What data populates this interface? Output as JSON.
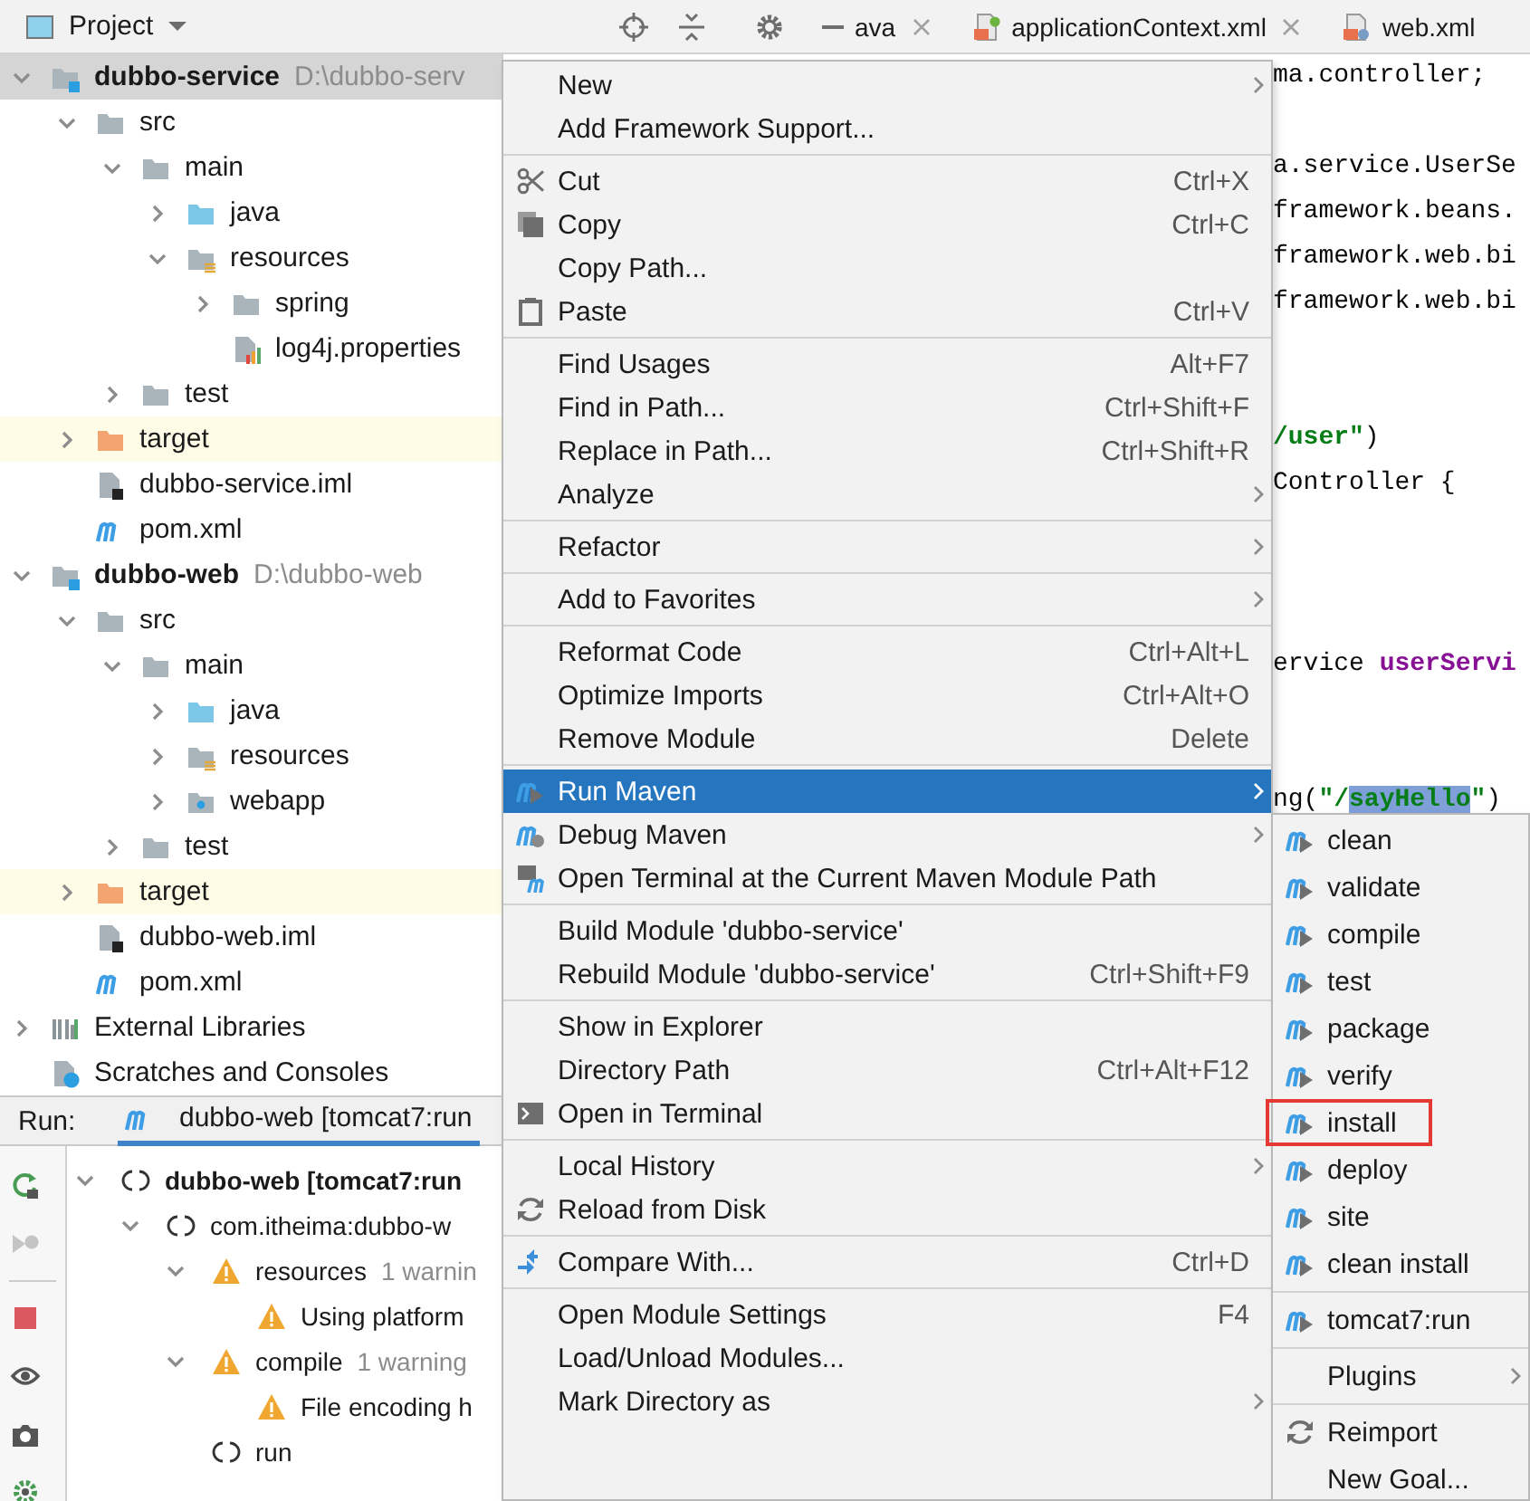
{
  "header": {
    "view": "Project",
    "tabs": [
      {
        "label": "ava",
        "selected": false,
        "closable": true
      },
      {
        "label": "applicationContext.xml",
        "kind": "spring-xml",
        "selected": false,
        "closable": true
      },
      {
        "label": "web.xml",
        "kind": "xml",
        "selected": false,
        "closable": false
      }
    ]
  },
  "project_tree": {
    "items": [
      {
        "label": "dubbo-service",
        "kind": "module",
        "path": "D:\\dubbo-serv",
        "expanded": true,
        "selected": true,
        "children": [
          {
            "label": "src",
            "kind": "folder",
            "expanded": true,
            "selected": false,
            "children": [
              {
                "label": "main",
                "kind": "folder",
                "expanded": true,
                "selected": false,
                "children": [
                  {
                    "label": "java",
                    "kind": "source-folder",
                    "expanded": false,
                    "selected": false
                  },
                  {
                    "label": "resources",
                    "kind": "resource-folder",
                    "expanded": true,
                    "selected": false,
                    "children": [
                      {
                        "label": "spring",
                        "kind": "folder",
                        "expanded": false,
                        "selected": false
                      },
                      {
                        "label": "log4j.properties",
                        "kind": "properties-file",
                        "selected": false
                      }
                    ]
                  }
                ]
              },
              {
                "label": "test",
                "kind": "folder",
                "expanded": false,
                "selected": false
              }
            ]
          },
          {
            "label": "target",
            "kind": "excluded-folder",
            "expanded": false,
            "selected": false
          },
          {
            "label": "dubbo-service.iml",
            "kind": "module-file",
            "selected": false
          },
          {
            "label": "pom.xml",
            "kind": "maven-file",
            "selected": false
          }
        ]
      },
      {
        "label": "dubbo-web",
        "kind": "module",
        "path": "D:\\dubbo-web",
        "expanded": true,
        "selected": false,
        "children": [
          {
            "label": "src",
            "kind": "folder",
            "expanded": true,
            "selected": false,
            "children": [
              {
                "label": "main",
                "kind": "folder",
                "expanded": true,
                "selected": false,
                "children": [
                  {
                    "label": "java",
                    "kind": "source-folder",
                    "expanded": false,
                    "selected": false
                  },
                  {
                    "label": "resources",
                    "kind": "resource-folder",
                    "expanded": false,
                    "selected": false
                  },
                  {
                    "label": "webapp",
                    "kind": "web-folder",
                    "expanded": false,
                    "selected": false
                  }
                ]
              },
              {
                "label": "test",
                "kind": "folder",
                "expanded": false,
                "selected": false
              }
            ]
          },
          {
            "label": "target",
            "kind": "excluded-folder",
            "expanded": false,
            "selected": false
          },
          {
            "label": "dubbo-web.iml",
            "kind": "module-file",
            "selected": false
          },
          {
            "label": "pom.xml",
            "kind": "maven-file",
            "selected": false
          }
        ]
      },
      {
        "label": "External Libraries",
        "kind": "libraries",
        "expanded": false,
        "selected": false
      },
      {
        "label": "Scratches and Consoles",
        "kind": "scratches",
        "selected": false
      }
    ]
  },
  "editor": {
    "lines": [
      {
        "kind": "code",
        "tokens": [
          {
            "text": "ma.controller;",
            "kind": "plain"
          }
        ]
      },
      {
        "kind": "blank"
      },
      {
        "kind": "code",
        "tokens": [
          {
            "text": "a.service.UserSe",
            "kind": "plain"
          }
        ]
      },
      {
        "kind": "code",
        "tokens": [
          {
            "text": "framework.beans.",
            "kind": "plain"
          }
        ]
      },
      {
        "kind": "code",
        "tokens": [
          {
            "text": "framework.web.bi",
            "kind": "plain"
          }
        ]
      },
      {
        "kind": "code",
        "tokens": [
          {
            "text": "framework.web.bi",
            "kind": "plain"
          }
        ]
      },
      {
        "kind": "blank"
      },
      {
        "kind": "blank"
      },
      {
        "kind": "code",
        "tokens": [
          {
            "text": "/user\"",
            "kind": "string"
          },
          {
            "text": ")",
            "kind": "plain"
          }
        ]
      },
      {
        "kind": "code",
        "tokens": [
          {
            "text": "Controller {",
            "kind": "plain"
          }
        ]
      },
      {
        "kind": "blank"
      },
      {
        "kind": "blank"
      },
      {
        "kind": "blank"
      },
      {
        "kind": "code",
        "tokens": [
          {
            "text": "ervice ",
            "kind": "plain"
          },
          {
            "text": "userServi",
            "kind": "field"
          }
        ]
      },
      {
        "kind": "blank"
      },
      {
        "kind": "blank"
      },
      {
        "kind": "code",
        "tokens": [
          {
            "text": "ng(",
            "kind": "plain"
          },
          {
            "text": "\"/",
            "kind": "string"
          },
          {
            "text": "sayHello",
            "kind": "match"
          },
          {
            "text": "\"",
            "kind": "string"
          },
          {
            "text": ")",
            "kind": "plain"
          }
        ]
      }
    ]
  },
  "run_panel": {
    "label": "Run:",
    "tab": {
      "label": "dubbo-web [tomcat7:run",
      "selected": true
    },
    "tools": [
      {
        "kind": "rerun",
        "disabled": false
      },
      {
        "kind": "rerun-failed",
        "disabled": true
      },
      {
        "kind": "stop",
        "disabled": false
      },
      {
        "kind": "view",
        "disabled": false
      },
      {
        "kind": "screenshot",
        "disabled": false
      },
      {
        "kind": "settings",
        "disabled": false
      }
    ],
    "tree": [
      {
        "label": "dubbo-web [tomcat7:run",
        "kind": "spinner",
        "expanded": true,
        "children": [
          {
            "label": "com.itheima:dubbo-w",
            "kind": "spinner",
            "expanded": true,
            "children": [
              {
                "label": "resources",
                "detail": "1 warnin",
                "kind": "warning",
                "expanded": true,
                "children": [
                  {
                    "label": "Using platform",
                    "kind": "warning"
                  }
                ]
              },
              {
                "label": "compile",
                "detail": "1 warning",
                "kind": "warning",
                "expanded": true,
                "children": [
                  {
                    "label": "File encoding h",
                    "kind": "warning"
                  }
                ]
              },
              {
                "label": "run",
                "kind": "spinner"
              }
            ]
          }
        ]
      }
    ]
  },
  "context_menu": {
    "items": [
      {
        "kind": "item",
        "label": "New",
        "submenu": true,
        "selected": false
      },
      {
        "kind": "item",
        "label": "Add Framework Support...",
        "submenu": false,
        "selected": false
      },
      {
        "kind": "separator"
      },
      {
        "kind": "cut",
        "label": "Cut",
        "shortcut": "Ctrl+X",
        "submenu": false,
        "selected": false
      },
      {
        "kind": "copy",
        "label": "Copy",
        "shortcut": "Ctrl+C",
        "submenu": false,
        "selected": false
      },
      {
        "kind": "item",
        "label": "Copy Path...",
        "submenu": false,
        "selected": false
      },
      {
        "kind": "paste",
        "label": "Paste",
        "shortcut": "Ctrl+V",
        "submenu": false,
        "selected": false
      },
      {
        "kind": "separator"
      },
      {
        "kind": "item",
        "label": "Find Usages",
        "shortcut": "Alt+F7",
        "submenu": false,
        "selected": false
      },
      {
        "kind": "item",
        "label": "Find in Path...",
        "shortcut": "Ctrl+Shift+F",
        "submenu": false,
        "selected": false
      },
      {
        "kind": "item",
        "label": "Replace in Path...",
        "shortcut": "Ctrl+Shift+R",
        "submenu": false,
        "selected": false
      },
      {
        "kind": "item",
        "label": "Analyze",
        "submenu": true,
        "selected": false
      },
      {
        "kind": "separator"
      },
      {
        "kind": "item",
        "label": "Refactor",
        "submenu": true,
        "selected": false
      },
      {
        "kind": "separator"
      },
      {
        "kind": "item",
        "label": "Add to Favorites",
        "submenu": true,
        "selected": false
      },
      {
        "kind": "separator"
      },
      {
        "kind": "item",
        "label": "Reformat Code",
        "shortcut": "Ctrl+Alt+L",
        "submenu": false,
        "selected": false
      },
      {
        "kind": "item",
        "label": "Optimize Imports",
        "shortcut": "Ctrl+Alt+O",
        "submenu": false,
        "selected": false
      },
      {
        "kind": "item",
        "label": "Remove Module",
        "shortcut": "Delete",
        "submenu": false,
        "selected": false
      },
      {
        "kind": "separator"
      },
      {
        "kind": "run-maven",
        "label": "Run Maven",
        "submenu": true,
        "selected": true
      },
      {
        "kind": "debug-maven",
        "label": "Debug Maven",
        "submenu": true,
        "selected": false
      },
      {
        "kind": "maven-terminal",
        "label": "Open Terminal at the Current Maven Module Path",
        "submenu": false,
        "selected": false
      },
      {
        "kind": "separator"
      },
      {
        "kind": "item",
        "label": "Build Module 'dubbo-service'",
        "submenu": false,
        "selected": false
      },
      {
        "kind": "item",
        "label": "Rebuild Module 'dubbo-service'",
        "shortcut": "Ctrl+Shift+F9",
        "submenu": false,
        "selected": false
      },
      {
        "kind": "separator"
      },
      {
        "kind": "item",
        "label": "Show in Explorer",
        "submenu": false,
        "selected": false
      },
      {
        "kind": "item",
        "label": "Directory Path",
        "shortcut": "Ctrl+Alt+F12",
        "submenu": false,
        "selected": false
      },
      {
        "kind": "terminal",
        "label": "Open in Terminal",
        "submenu": false,
        "selected": false
      },
      {
        "kind": "separator"
      },
      {
        "kind": "item",
        "label": "Local History",
        "submenu": true,
        "selected": false
      },
      {
        "kind": "reload",
        "label": "Reload from Disk",
        "submenu": false,
        "selected": false
      },
      {
        "kind": "separator"
      },
      {
        "kind": "compare",
        "label": "Compare With...",
        "shortcut": "Ctrl+D",
        "submenu": false,
        "selected": false
      },
      {
        "kind": "separator"
      },
      {
        "kind": "item",
        "label": "Open Module Settings",
        "shortcut": "F4",
        "submenu": false,
        "selected": false
      },
      {
        "kind": "item",
        "label": "Load/Unload Modules...",
        "submenu": false,
        "selected": false
      },
      {
        "kind": "item",
        "label": "Mark Directory as",
        "submenu": true,
        "selected": false
      }
    ]
  },
  "maven_submenu": {
    "items": [
      {
        "kind": "goal",
        "label": "clean",
        "selected": false,
        "highlighted": false
      },
      {
        "kind": "goal",
        "label": "validate",
        "selected": false,
        "highlighted": false
      },
      {
        "kind": "goal",
        "label": "compile",
        "selected": false,
        "highlighted": false
      },
      {
        "kind": "goal",
        "label": "test",
        "selected": false,
        "highlighted": false
      },
      {
        "kind": "goal",
        "label": "package",
        "selected": false,
        "highlighted": false
      },
      {
        "kind": "goal",
        "label": "verify",
        "selected": false,
        "highlighted": false
      },
      {
        "kind": "goal",
        "label": "install",
        "selected": false,
        "highlighted": true
      },
      {
        "kind": "goal",
        "label": "deploy",
        "selected": false,
        "highlighted": false
      },
      {
        "kind": "goal",
        "label": "site",
        "selected": false,
        "highlighted": false
      },
      {
        "kind": "goal",
        "label": "clean install",
        "selected": false,
        "highlighted": false
      },
      {
        "kind": "separator"
      },
      {
        "kind": "goal",
        "label": "tomcat7:run",
        "selected": false,
        "highlighted": false
      },
      {
        "kind": "separator"
      },
      {
        "kind": "item",
        "label": "Plugins",
        "submenu": true,
        "selected": false,
        "highlighted": false
      },
      {
        "kind": "separator"
      },
      {
        "kind": "reload",
        "label": "Reimport",
        "selected": false,
        "highlighted": false
      },
      {
        "kind": "item",
        "label": "New Goal...",
        "selected": false,
        "highlighted": false
      }
    ]
  }
}
